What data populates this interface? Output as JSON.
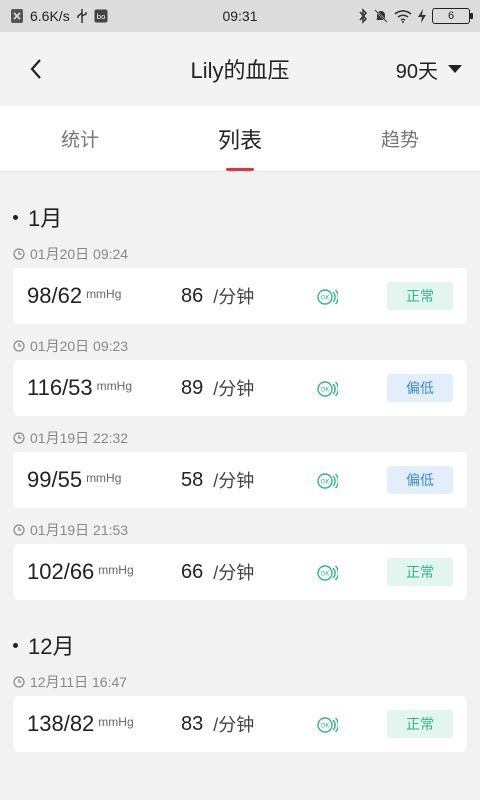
{
  "status": {
    "speed": "6.6K/s",
    "time": "09:31",
    "battery": "6"
  },
  "nav": {
    "title": "Lily的血压",
    "range": "90天"
  },
  "tabs": [
    "统计",
    "列表",
    "趋势"
  ],
  "sections": [
    {
      "month": "1月",
      "entries": [
        {
          "time": "01月20日 09:24",
          "bp": "98/62",
          "unit": "mmHg",
          "pulse": "86",
          "pulse_unit": "/分钟",
          "status": "正常"
        },
        {
          "time": "01月20日 09:23",
          "bp": "116/53",
          "unit": "mmHg",
          "pulse": "89",
          "pulse_unit": "/分钟",
          "status": "偏低"
        },
        {
          "time": "01月19日 22:32",
          "bp": "99/55",
          "unit": "mmHg",
          "pulse": "58",
          "pulse_unit": "/分钟",
          "status": "偏低"
        },
        {
          "time": "01月19日 21:53",
          "bp": "102/66",
          "unit": "mmHg",
          "pulse": "66",
          "pulse_unit": "/分钟",
          "status": "正常"
        }
      ]
    },
    {
      "month": "12月",
      "entries": [
        {
          "time": "12月11日 16:47",
          "bp": "138/82",
          "unit": "mmHg",
          "pulse": "83",
          "pulse_unit": "/分钟",
          "status": "正常"
        }
      ]
    }
  ],
  "colors": {
    "accent": "#e5353a",
    "normal_text": "#2fb489",
    "normal_bg": "#e2f5ee",
    "low_text": "#3a8ed8",
    "low_bg": "#e2eef9"
  }
}
